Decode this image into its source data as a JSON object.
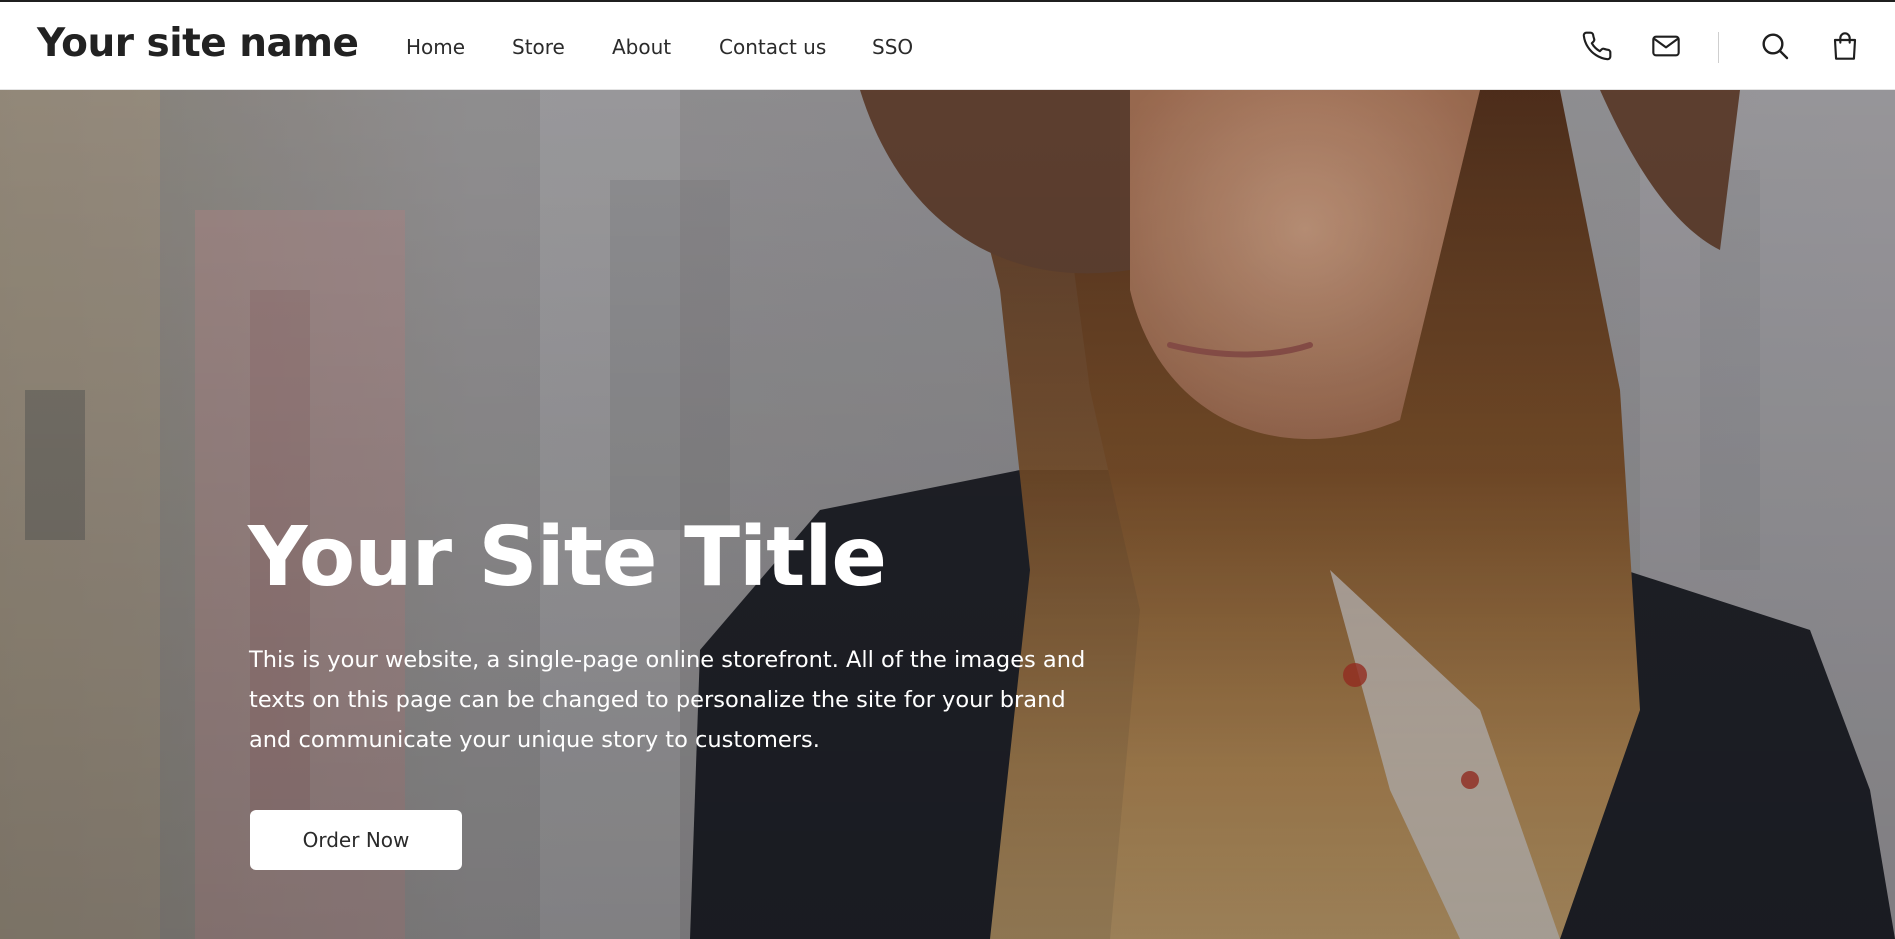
{
  "header": {
    "site_name": "Your site name",
    "nav": [
      {
        "label": "Home"
      },
      {
        "label": "Store"
      },
      {
        "label": "About"
      },
      {
        "label": "Contact us"
      },
      {
        "label": "SSO"
      }
    ],
    "icons": {
      "phone": "phone-icon",
      "mail": "mail-icon",
      "search": "search-icon",
      "cart": "shopping-bag-icon"
    }
  },
  "hero": {
    "title": "Your Site Title",
    "text": "This is your website, a single-page online storefront. All of the images and texts on this page can be changed to personalize the site for your brand and communicate your unique story to customers.",
    "button_label": "Order Now",
    "image": "woman-in-hat-photo"
  },
  "colors": {
    "header_bg": "#ffffff",
    "text_dark": "#222222",
    "hero_text": "#ffffff",
    "button_bg": "#ffffff"
  }
}
